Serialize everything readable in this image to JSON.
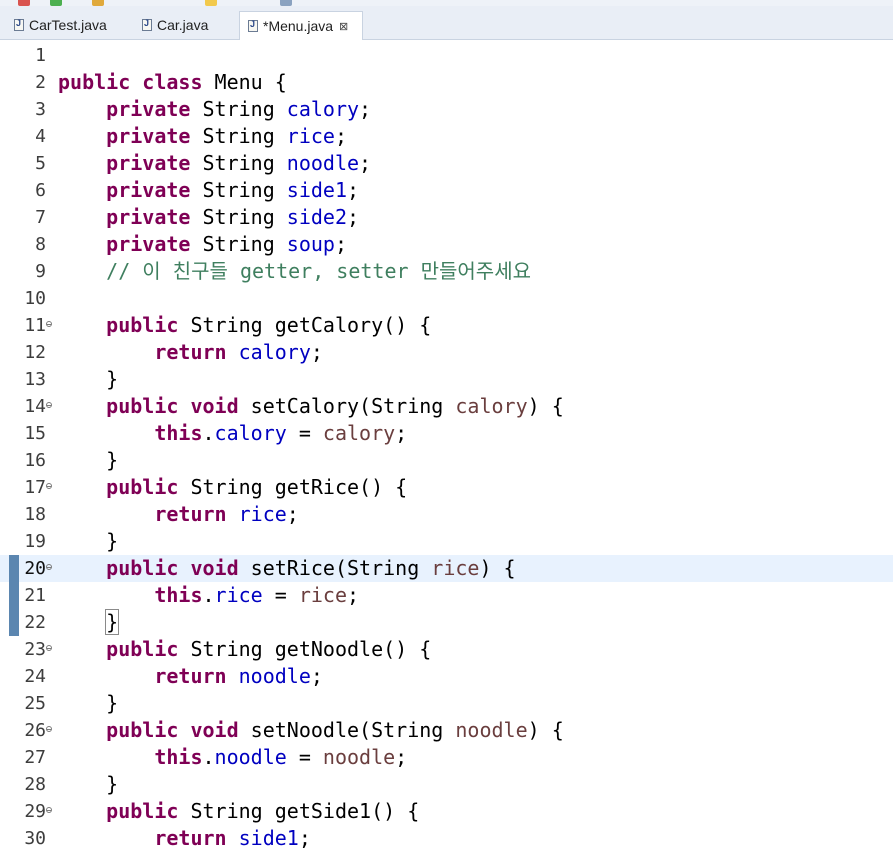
{
  "tabs": [
    {
      "label": "CarTest.java",
      "active": false
    },
    {
      "label": "Car.java",
      "active": false
    },
    {
      "label": "*Menu.java",
      "active": true
    }
  ],
  "close_glyph": "⊠",
  "editor": {
    "current_line": 20,
    "changed_lines": [
      20,
      21,
      22
    ],
    "lines": [
      {
        "n": "1",
        "fold": false,
        "tokens": []
      },
      {
        "n": "2",
        "fold": false,
        "tokens": [
          [
            "kw",
            "public"
          ],
          [
            "t",
            " "
          ],
          [
            "kw",
            "class"
          ],
          [
            "t",
            " Menu {"
          ]
        ]
      },
      {
        "n": "3",
        "fold": false,
        "tokens": [
          [
            "t",
            "    "
          ],
          [
            "kw",
            "private"
          ],
          [
            "t",
            " String "
          ],
          [
            "fld",
            "calory"
          ],
          [
            "t",
            ";"
          ]
        ]
      },
      {
        "n": "4",
        "fold": false,
        "tokens": [
          [
            "t",
            "    "
          ],
          [
            "kw",
            "private"
          ],
          [
            "t",
            " String "
          ],
          [
            "fld",
            "rice"
          ],
          [
            "t",
            ";"
          ]
        ]
      },
      {
        "n": "5",
        "fold": false,
        "tokens": [
          [
            "t",
            "    "
          ],
          [
            "kw",
            "private"
          ],
          [
            "t",
            " String "
          ],
          [
            "fld",
            "noodle"
          ],
          [
            "t",
            ";"
          ]
        ]
      },
      {
        "n": "6",
        "fold": false,
        "tokens": [
          [
            "t",
            "    "
          ],
          [
            "kw",
            "private"
          ],
          [
            "t",
            " String "
          ],
          [
            "fld",
            "side1"
          ],
          [
            "t",
            ";"
          ]
        ]
      },
      {
        "n": "7",
        "fold": false,
        "tokens": [
          [
            "t",
            "    "
          ],
          [
            "kw",
            "private"
          ],
          [
            "t",
            " String "
          ],
          [
            "fld",
            "side2"
          ],
          [
            "t",
            ";"
          ]
        ]
      },
      {
        "n": "8",
        "fold": false,
        "tokens": [
          [
            "t",
            "    "
          ],
          [
            "kw",
            "private"
          ],
          [
            "t",
            " String "
          ],
          [
            "fld",
            "soup"
          ],
          [
            "t",
            ";"
          ]
        ]
      },
      {
        "n": "9",
        "fold": false,
        "tokens": [
          [
            "t",
            "    "
          ],
          [
            "cmt",
            "// 이 친구들 getter, setter 만들어주세요"
          ]
        ]
      },
      {
        "n": "10",
        "fold": false,
        "tokens": []
      },
      {
        "n": "11",
        "fold": true,
        "tokens": [
          [
            "t",
            "    "
          ],
          [
            "kw",
            "public"
          ],
          [
            "t",
            " String getCalory() {"
          ]
        ]
      },
      {
        "n": "12",
        "fold": false,
        "tokens": [
          [
            "t",
            "        "
          ],
          [
            "kw",
            "return"
          ],
          [
            "t",
            " "
          ],
          [
            "fld",
            "calory"
          ],
          [
            "t",
            ";"
          ]
        ]
      },
      {
        "n": "13",
        "fold": false,
        "tokens": [
          [
            "t",
            "    }"
          ]
        ]
      },
      {
        "n": "14",
        "fold": true,
        "tokens": [
          [
            "t",
            "    "
          ],
          [
            "kw",
            "public"
          ],
          [
            "t",
            " "
          ],
          [
            "kw",
            "void"
          ],
          [
            "t",
            " setCalory(String "
          ],
          [
            "prm",
            "calory"
          ],
          [
            "t",
            ") {"
          ]
        ]
      },
      {
        "n": "15",
        "fold": false,
        "tokens": [
          [
            "t",
            "        "
          ],
          [
            "kw",
            "this"
          ],
          [
            "t",
            "."
          ],
          [
            "fld",
            "calory"
          ],
          [
            "t",
            " = "
          ],
          [
            "prm",
            "calory"
          ],
          [
            "t",
            ";"
          ]
        ]
      },
      {
        "n": "16",
        "fold": false,
        "tokens": [
          [
            "t",
            "    }"
          ]
        ]
      },
      {
        "n": "17",
        "fold": true,
        "tokens": [
          [
            "t",
            "    "
          ],
          [
            "kw",
            "public"
          ],
          [
            "t",
            " String getRice() {"
          ]
        ]
      },
      {
        "n": "18",
        "fold": false,
        "tokens": [
          [
            "t",
            "        "
          ],
          [
            "kw",
            "return"
          ],
          [
            "t",
            " "
          ],
          [
            "fld",
            "rice"
          ],
          [
            "t",
            ";"
          ]
        ]
      },
      {
        "n": "19",
        "fold": false,
        "tokens": [
          [
            "t",
            "    }"
          ]
        ]
      },
      {
        "n": "20",
        "fold": true,
        "tokens": [
          [
            "t",
            "    "
          ],
          [
            "kw",
            "public"
          ],
          [
            "t",
            " "
          ],
          [
            "kw",
            "void"
          ],
          [
            "t",
            " setRice(String "
          ],
          [
            "prm",
            "rice"
          ],
          [
            "t",
            ") {"
          ]
        ]
      },
      {
        "n": "21",
        "fold": false,
        "tokens": [
          [
            "t",
            "        "
          ],
          [
            "kw",
            "this"
          ],
          [
            "t",
            "."
          ],
          [
            "fld",
            "rice"
          ],
          [
            "t",
            " = "
          ],
          [
            "prm",
            "rice"
          ],
          [
            "t",
            ";"
          ]
        ]
      },
      {
        "n": "22",
        "fold": false,
        "tokens": [
          [
            "t",
            "    "
          ],
          [
            "box",
            "}"
          ]
        ]
      },
      {
        "n": "23",
        "fold": true,
        "tokens": [
          [
            "t",
            "    "
          ],
          [
            "kw",
            "public"
          ],
          [
            "t",
            " String getNoodle() {"
          ]
        ]
      },
      {
        "n": "24",
        "fold": false,
        "tokens": [
          [
            "t",
            "        "
          ],
          [
            "kw",
            "return"
          ],
          [
            "t",
            " "
          ],
          [
            "fld",
            "noodle"
          ],
          [
            "t",
            ";"
          ]
        ]
      },
      {
        "n": "25",
        "fold": false,
        "tokens": [
          [
            "t",
            "    }"
          ]
        ]
      },
      {
        "n": "26",
        "fold": true,
        "tokens": [
          [
            "t",
            "    "
          ],
          [
            "kw",
            "public"
          ],
          [
            "t",
            " "
          ],
          [
            "kw",
            "void"
          ],
          [
            "t",
            " setNoodle(String "
          ],
          [
            "prm",
            "noodle"
          ],
          [
            "t",
            ") {"
          ]
        ]
      },
      {
        "n": "27",
        "fold": false,
        "tokens": [
          [
            "t",
            "        "
          ],
          [
            "kw",
            "this"
          ],
          [
            "t",
            "."
          ],
          [
            "fld",
            "noodle"
          ],
          [
            "t",
            " = "
          ],
          [
            "prm",
            "noodle"
          ],
          [
            "t",
            ";"
          ]
        ]
      },
      {
        "n": "28",
        "fold": false,
        "tokens": [
          [
            "t",
            "    }"
          ]
        ]
      },
      {
        "n": "29",
        "fold": true,
        "tokens": [
          [
            "t",
            "    "
          ],
          [
            "kw",
            "public"
          ],
          [
            "t",
            " String getSide1() {"
          ]
        ]
      },
      {
        "n": "30",
        "fold": false,
        "tokens": [
          [
            "t",
            "        "
          ],
          [
            "kw",
            "return"
          ],
          [
            "t",
            " "
          ],
          [
            "fld",
            "side1"
          ],
          [
            "t",
            ";"
          ]
        ]
      }
    ]
  }
}
